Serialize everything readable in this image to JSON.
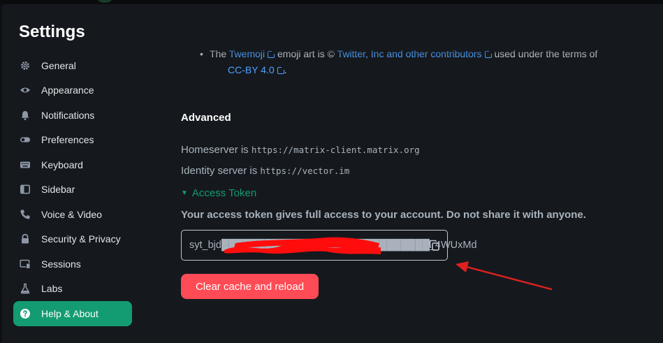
{
  "dialog": {
    "title": "Settings"
  },
  "sidebar": {
    "items": [
      {
        "label": "General",
        "icon": "gear-icon"
      },
      {
        "label": "Appearance",
        "icon": "eye-icon"
      },
      {
        "label": "Notifications",
        "icon": "bell-icon"
      },
      {
        "label": "Preferences",
        "icon": "toggle-icon"
      },
      {
        "label": "Keyboard",
        "icon": "keyboard-icon"
      },
      {
        "label": "Sidebar",
        "icon": "sidebar-icon"
      },
      {
        "label": "Voice & Video",
        "icon": "phone-icon"
      },
      {
        "label": "Security & Privacy",
        "icon": "lock-icon"
      },
      {
        "label": "Sessions",
        "icon": "devices-icon"
      },
      {
        "label": "Labs",
        "icon": "flask-icon"
      },
      {
        "label": "Help & About",
        "icon": "help-icon",
        "active": true
      }
    ]
  },
  "credits": {
    "bullet": "•",
    "prefix": "The",
    "twemoji_link": "Twemoji",
    "middle": "emoji art is ©",
    "twitter_link": "Twitter, Inc and other contributors",
    "suffix": "used under the terms of",
    "license_link": "CC-BY 4.0",
    "end": "."
  },
  "advanced": {
    "heading": "Advanced",
    "homeserver_label": "Homeserver is",
    "homeserver_value": "https://matrix-client.matrix.org",
    "identity_label": "Identity server is",
    "identity_value": "https://vector.im",
    "token_toggle": "Access Token",
    "token_warning": "Your access token gives full access to your account. Do not share it with anyone.",
    "token_value": "syt_bjd█████████████████████████████_4WUxMd",
    "clear_button": "Clear cache and reload"
  },
  "colors": {
    "accent": "#139b71",
    "danger": "#ff4b55",
    "link": "#4fa2ff",
    "annotation": "#e02020"
  }
}
